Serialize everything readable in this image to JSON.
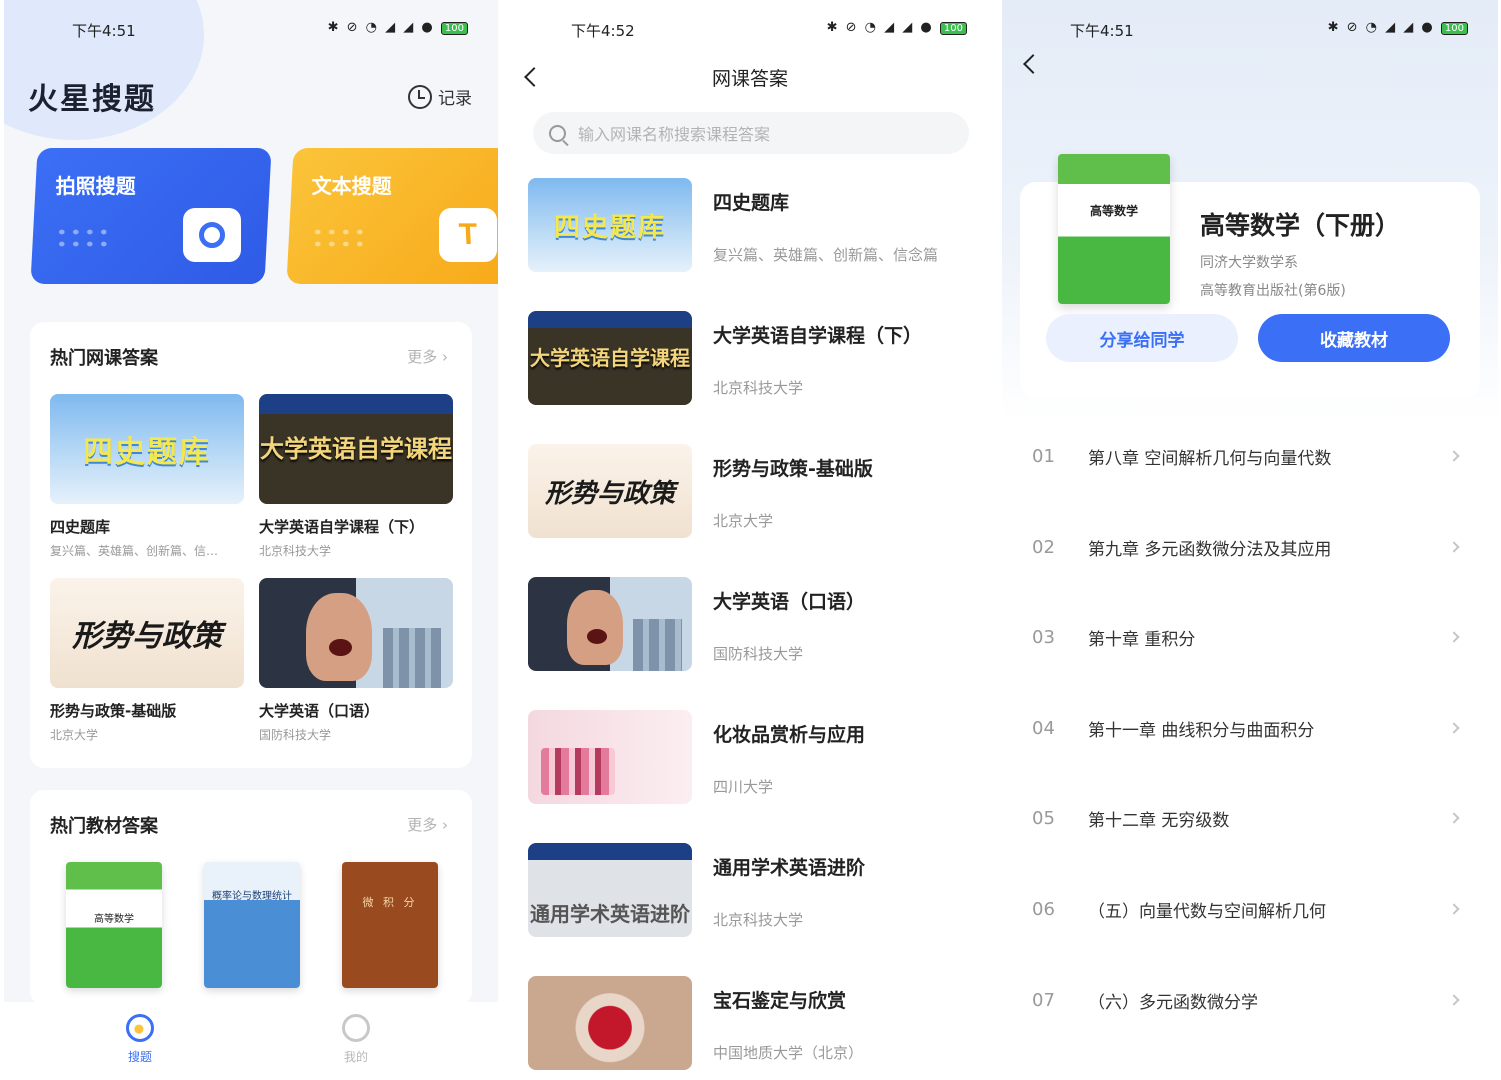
{
  "screen1": {
    "status_time": "下午4:51",
    "status_icons": "✱ ⊘ ◔ ◢ ◢ ●",
    "battery": "100",
    "app_title": "火星搜题",
    "record_label": "记录",
    "photo_search_label": "拍照搜题",
    "text_search_label": "文本搜题",
    "hot_courses": {
      "title": "热门网课答案",
      "more": "更多 ›",
      "items": [
        {
          "cover_text": "四史题库",
          "name": "四史题库",
          "sub": "复兴篇、英雄篇、创新篇、信…"
        },
        {
          "cover_text": "大学英语自学课程",
          "name": "大学英语自学课程（下）",
          "sub": "北京科技大学"
        },
        {
          "cover_text": "形势与政策",
          "name": "形势与政策-基础版",
          "sub": "北京大学"
        },
        {
          "cover_text": "",
          "name": "大学英语（口语）",
          "sub": "国防科技大学"
        }
      ]
    },
    "hot_textbooks": {
      "title": "热门教材答案",
      "more": "更多 ›",
      "books": [
        {
          "cover_text": "高等数学"
        },
        {
          "cover_text": "概率论与数理统计"
        },
        {
          "cover_text": "微 积 分"
        }
      ]
    },
    "tabs": [
      {
        "label": "搜题"
      },
      {
        "label": "我的"
      }
    ]
  },
  "screen2": {
    "status_time": "下午4:52",
    "status_icons": "✱ ⊘ ◔ ◢ ◢ ●",
    "battery": "100",
    "title": "网课答案",
    "search_placeholder": "输入网课名称搜索课程答案",
    "courses": [
      {
        "cover_text": "四史题库",
        "name": "四史题库",
        "sub": "复兴篇、英雄篇、创新篇、信念篇"
      },
      {
        "cover_text": "大学英语自学课程",
        "name": "大学英语自学课程（下）",
        "sub": "北京科技大学"
      },
      {
        "cover_text": "形势与政策",
        "name": "形势与政策-基础版",
        "sub": "北京大学"
      },
      {
        "cover_text": "",
        "name": "大学英语（口语）",
        "sub": "国防科技大学"
      },
      {
        "cover_text": "",
        "name": "化妆品赏析与应用",
        "sub": "四川大学"
      },
      {
        "cover_text": "通用学术英语进阶",
        "name": "通用学术英语进阶",
        "sub": "北京科技大学"
      },
      {
        "cover_text": "",
        "name": "宝石鉴定与欣赏",
        "sub": "中国地质大学（北京）"
      }
    ]
  },
  "screen3": {
    "status_time": "下午4:51",
    "status_icons": "✱ ⊘ ◔ ◢ ◢ ●",
    "battery": "100",
    "book_cover_text": "高等数学",
    "book_title": "高等数学（下册）",
    "book_author": "同济大学数学系",
    "book_publisher": "高等教育出版社(第6版)",
    "share_label": "分享给同学",
    "favorite_label": "收藏教材",
    "chapters": [
      {
        "num": "01",
        "name": "第八章 空间解析几何与向量代数"
      },
      {
        "num": "02",
        "name": "第九章 多元函数微分法及其应用"
      },
      {
        "num": "03",
        "name": "第十章 重积分"
      },
      {
        "num": "04",
        "name": "第十一章 曲线积分与曲面积分"
      },
      {
        "num": "05",
        "name": "第十二章 无穷级数"
      },
      {
        "num": "06",
        "name": "（五）向量代数与空间解析几何"
      },
      {
        "num": "07",
        "name": "（六）多元函数微分学"
      }
    ]
  },
  "colors": {
    "accent_blue": "#3b6ff5",
    "accent_yellow": "#f7a918"
  }
}
